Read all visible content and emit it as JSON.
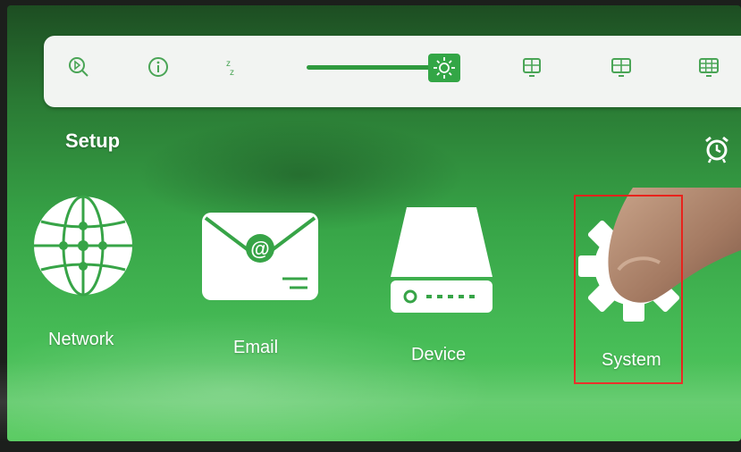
{
  "toolbar": {
    "icons": [
      "search-play-icon",
      "info-icon",
      "sleep-icon",
      "brightness-icon",
      "layout-single-icon",
      "layout-quad-icon",
      "layout-grid-icon"
    ],
    "brightness_level": 0.85
  },
  "setup": {
    "title": "Setup",
    "items": [
      {
        "label": "Network",
        "icon": "globe-network-icon"
      },
      {
        "label": "Email",
        "icon": "envelope-at-icon"
      },
      {
        "label": "Device",
        "icon": "hard-drive-icon"
      },
      {
        "label": "System",
        "icon": "gear-icon"
      }
    ]
  },
  "alarm_icon": "alarm-clock-icon",
  "colors": {
    "accent": "#37a447",
    "highlight_box": "#e8231c",
    "toolbar_bg": "#f2f4f2"
  }
}
